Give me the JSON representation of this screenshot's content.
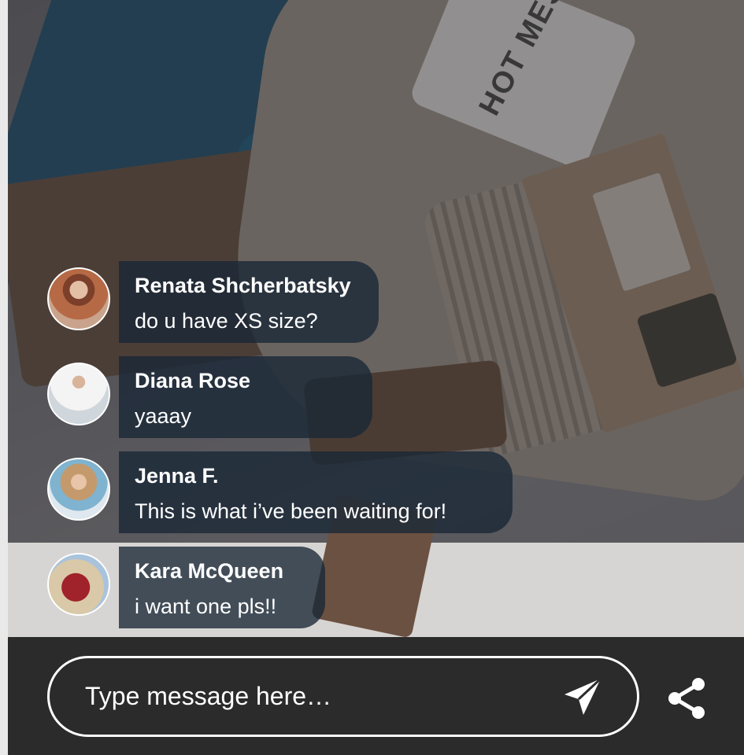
{
  "messages": [
    {
      "name": "Renata Shcherbatsky",
      "text": "do u have XS size?"
    },
    {
      "name": "Diana Rose",
      "text": "yaaay"
    },
    {
      "name": "Jenna F.",
      "text": "This is what i’ve been waiting for!"
    },
    {
      "name": "Kara McQueen",
      "text": "i want one pls!!"
    }
  ],
  "composer": {
    "placeholder": "Type message here…",
    "send_icon": "send-paper-plane-icon",
    "share_icon": "share-icon"
  },
  "background": {
    "mug_text": "HOT MES"
  },
  "colors": {
    "bubble": "#182636",
    "bar": "#2b2b2b",
    "text": "#ffffff"
  }
}
